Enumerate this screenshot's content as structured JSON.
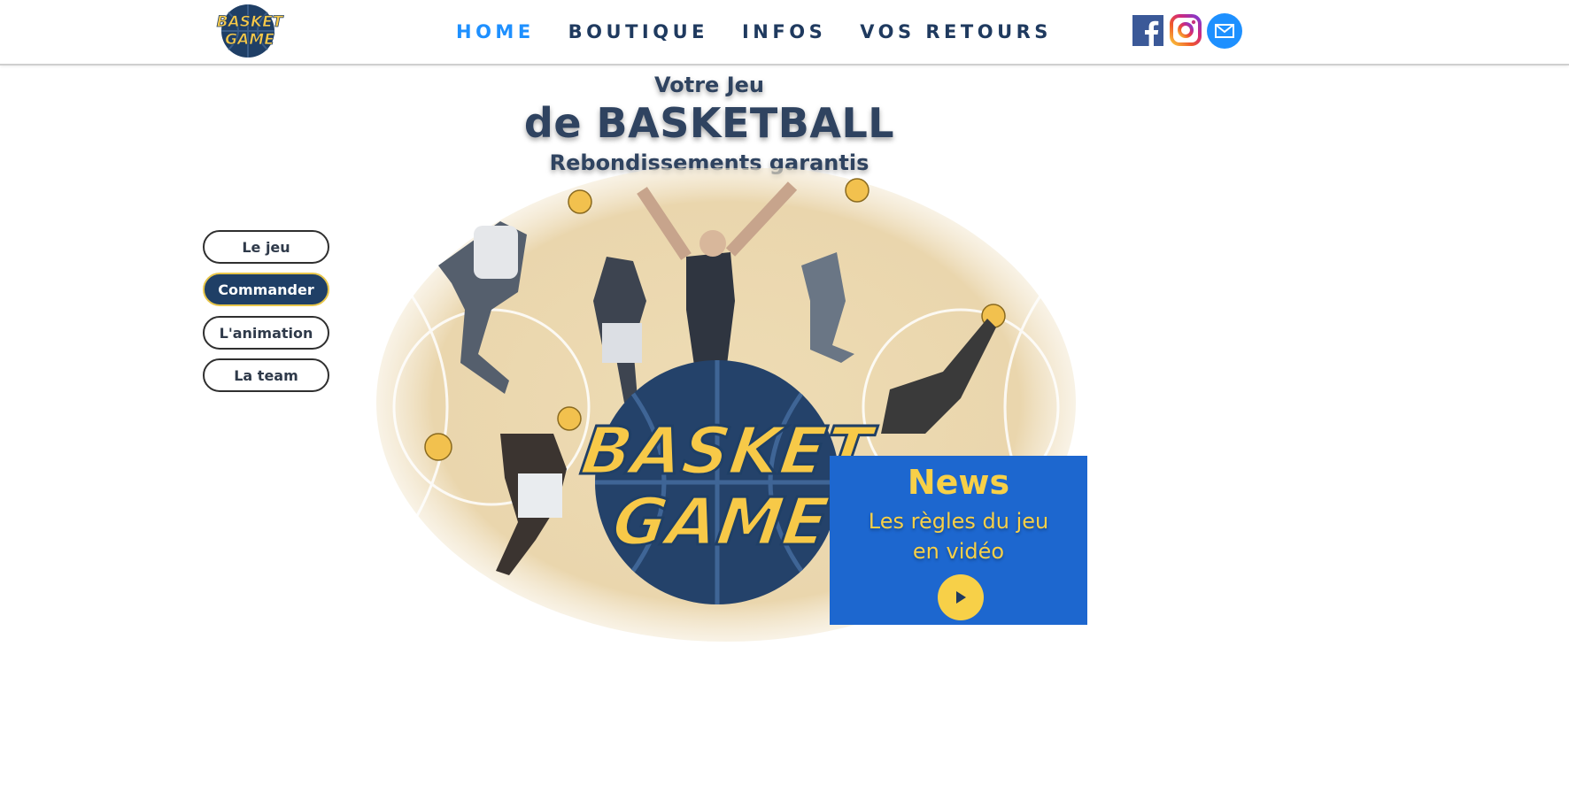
{
  "brand": {
    "logo_text_line1": "BASKET",
    "logo_text_line2": "GAME",
    "accent": "#1e90ff",
    "navy": "#1f3a5f",
    "yellow": "#f7d048"
  },
  "nav": {
    "items": [
      {
        "label": "HOME",
        "active": true
      },
      {
        "label": "BOUTIQUE",
        "active": false
      },
      {
        "label": "INFOS",
        "active": false
      },
      {
        "label": "VOS RETOURS",
        "active": false
      }
    ]
  },
  "social": {
    "icons": [
      "facebook-icon",
      "instagram-icon",
      "mail-icon"
    ]
  },
  "hero": {
    "line1": "Votre Jeu",
    "line2": "de BASKETBALL",
    "line3": "Rebondissements garantis",
    "illustration_text_line1": "BASKET",
    "illustration_text_line2": "GAME",
    "jersey_text": "BASKET GAME"
  },
  "side_menu": {
    "items": [
      {
        "label": "Le jeu",
        "active": false
      },
      {
        "label": "Commander",
        "active": true
      },
      {
        "label": "L'animation",
        "active": false
      },
      {
        "label": "La team",
        "active": false
      }
    ]
  },
  "news": {
    "title": "News",
    "line1": "Les règles du jeu",
    "line2": "en vidéo",
    "bg_color": "#1d67cf"
  }
}
